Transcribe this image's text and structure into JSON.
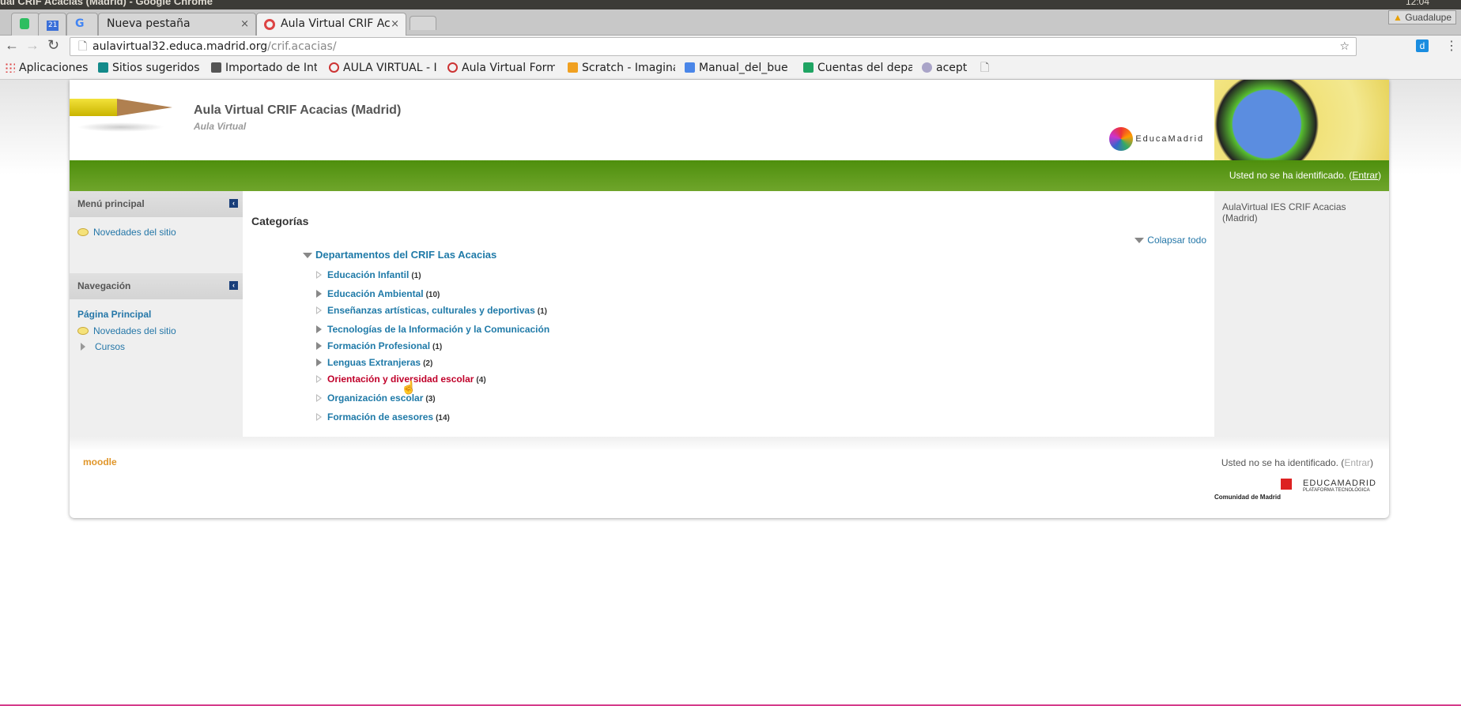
{
  "window": {
    "title": "ual CRIF Acacias (Madrid) - Google Chrome",
    "user": "Guadalupe",
    "clock": "12:04"
  },
  "tabs": [
    {
      "label": ""
    },
    {
      "label": "21"
    },
    {
      "label": ""
    },
    {
      "label": "Nueva pestaña"
    },
    {
      "label": "Aula Virtual CRIF Ac"
    }
  ],
  "address": {
    "host": "aulavirtual32.educa.madrid.org",
    "path": "/crif.acacias/"
  },
  "bookmarks": [
    "Aplicaciones",
    "Sitios sugeridos",
    "Importado de Int",
    "AULA VIRTUAL - I",
    "Aula Virtual Form",
    "Scratch - Imagina",
    "Manual_del_bue",
    "Cuentas del depa",
    "acept"
  ],
  "header": {
    "title": "Aula Virtual CRIF Acacias (Madrid)",
    "subtitle": "Aula Virtual",
    "logo_text": "EducaMadrid"
  },
  "login": {
    "text": "Usted no se ha identificado. (",
    "link": "Entrar",
    "close": ")"
  },
  "left": {
    "menu_title": "Menú principal",
    "menu_items": [
      "Novedades del sitio"
    ],
    "nav_title": "Navegación",
    "nav_home": "Página Principal",
    "nav_items": [
      "Novedades del sitio",
      "Cursos"
    ]
  },
  "main": {
    "heading": "Categorías",
    "collapse_all": "Colapsar todo",
    "parent": "Departamentos del CRIF Las Acacias",
    "categories": [
      {
        "name": "Educación Infantil",
        "count": "(1)"
      },
      {
        "name": "Educación Ambiental",
        "count": "(10)"
      },
      {
        "name": "Enseñanzas artísticas, culturales y deportivas",
        "count": "(1)"
      },
      {
        "name": "Tecnologías de la Información y la Comunicación",
        "count": ""
      },
      {
        "name": "Formación Profesional",
        "count": "(1)"
      },
      {
        "name": "Lenguas Extranjeras",
        "count": "(2)"
      },
      {
        "name": "Orientación y diversidad escolar",
        "count": "(4)"
      },
      {
        "name": "Organización escolar",
        "count": "(3)"
      },
      {
        "name": "Formación de asesores",
        "count": "(14)"
      }
    ]
  },
  "right": {
    "text": "AulaVirtual IES CRIF Acacias (Madrid)"
  },
  "footer": {
    "moodle": "moodle",
    "login_text": "Usted no se ha identificado. (",
    "login_link": "Entrar",
    "login_close": ")",
    "cm": "Comunidad de Madrid",
    "educa": "EDUCAMADRID",
    "educa_sub": "PLATAFORMA TECNOLÓGICA"
  },
  "colors": {
    "green": "#5a9a1a",
    "link": "#1f7aa8",
    "hover": "#c0002a"
  }
}
